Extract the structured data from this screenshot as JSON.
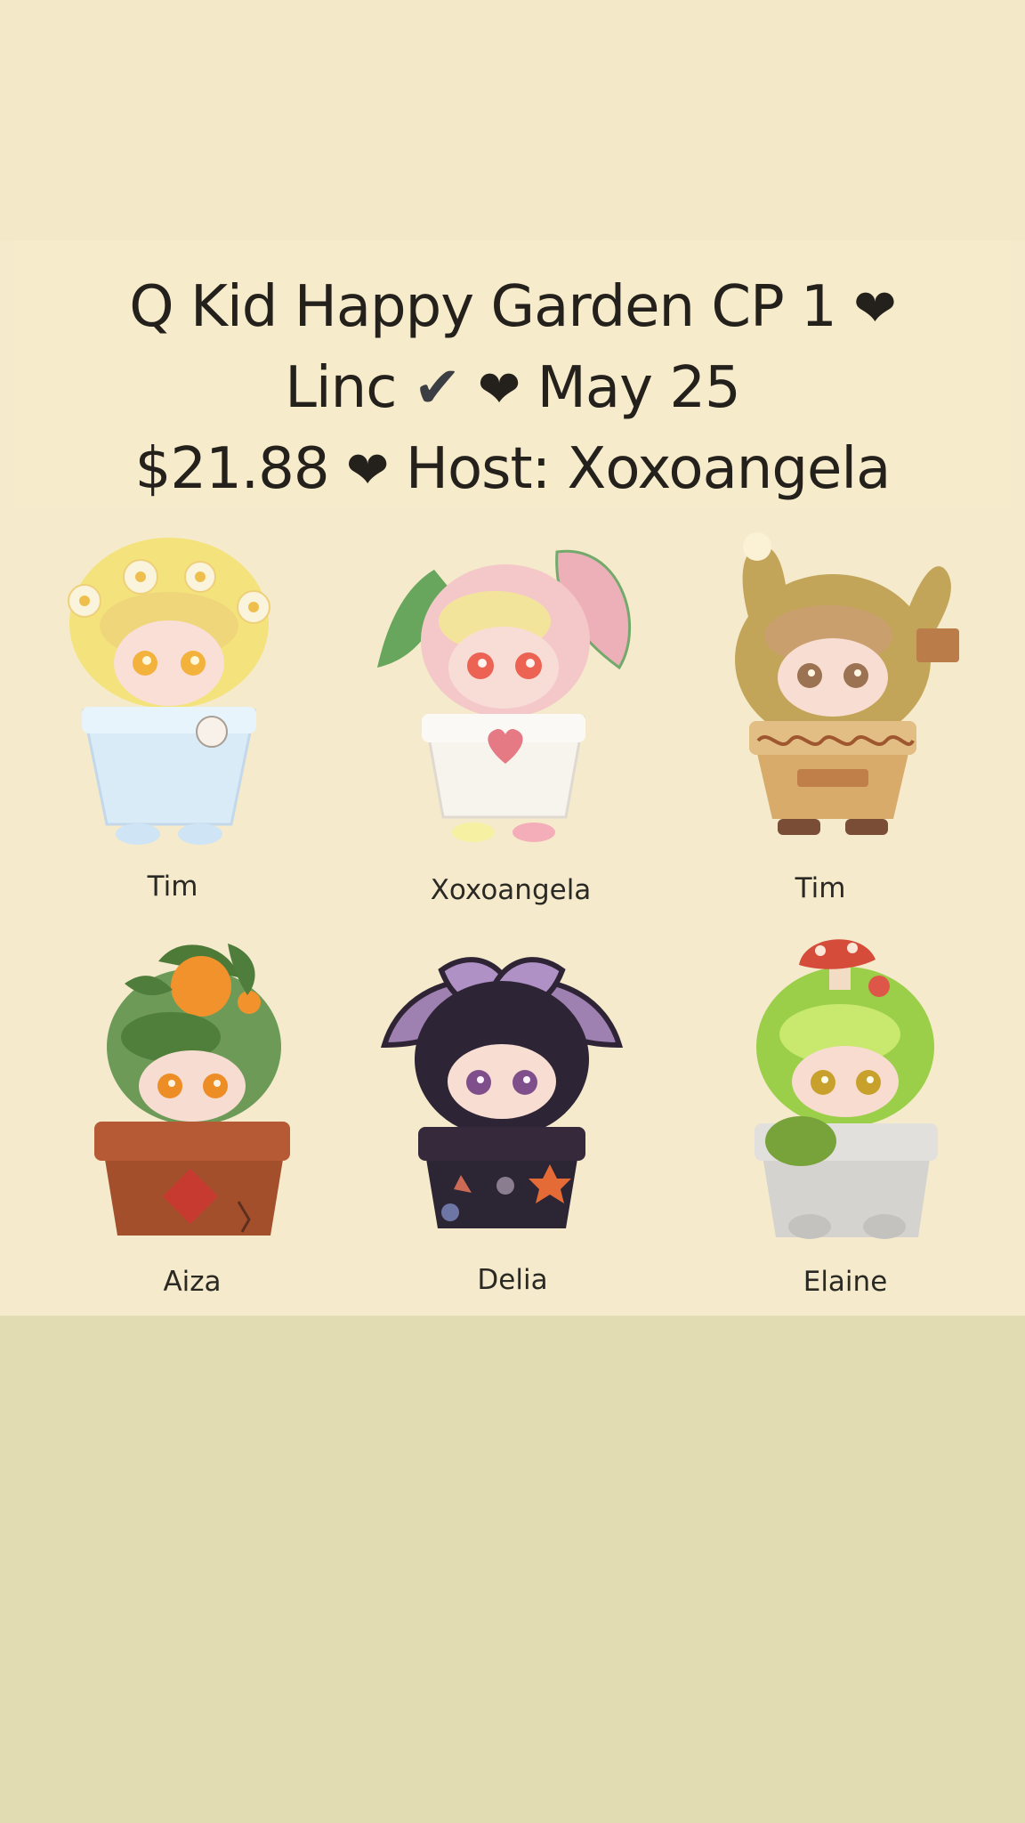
{
  "title": {
    "line1_text": "Q Kid Happy Garden CP 1",
    "line1_heart": "❤",
    "line2_text": "Linc",
    "line2_check": "✔",
    "line2_heart": "❤",
    "line2_date": "May 25",
    "line3_price": "$21.88",
    "line3_heart": "❤",
    "line3_host": "Host: Xoxoangela"
  },
  "figures": [
    {
      "name": "Tim",
      "icon": "flower-cloud-figure-icon",
      "colors": {
        "hair": "#f6e57a",
        "pot": "#d9ebf7"
      }
    },
    {
      "name": "Xoxoangela",
      "icon": "pink-leaf-figure-icon",
      "colors": {
        "hair": "#f4c8c9",
        "pot": "#f7f4ee"
      }
    },
    {
      "name": "Tim",
      "icon": "cactus-bunny-figure-icon",
      "colors": {
        "hair": "#c3a55a",
        "pot": "#d8ab6b"
      }
    },
    {
      "name": "Aiza",
      "icon": "orange-tree-figure-icon",
      "colors": {
        "hair": "#6e9a58",
        "pot": "#a44f2c"
      }
    },
    {
      "name": "Delia",
      "icon": "purple-leaf-figure-icon",
      "colors": {
        "hair": "#2d2536",
        "pot": "#2c2533"
      }
    },
    {
      "name": "Elaine",
      "icon": "moss-mushroom-figure-icon",
      "colors": {
        "hair": "#9bcf49",
        "pot": "#d5d3cf"
      }
    }
  ]
}
